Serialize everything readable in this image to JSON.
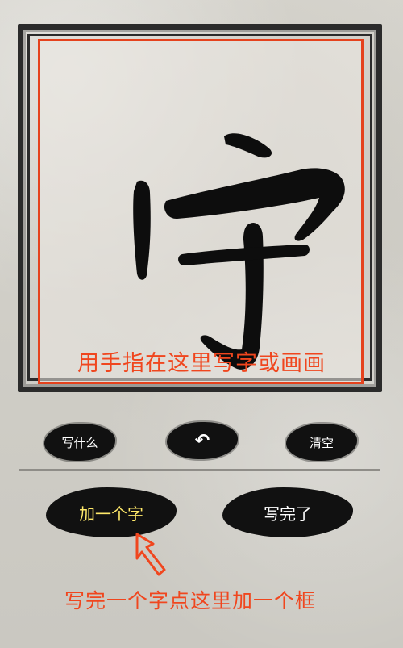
{
  "canvas": {
    "instruction": "用手指在这里写字或画画",
    "current_character": "字"
  },
  "toolbar": {
    "what_to_write": "写什么",
    "undo_icon": "undo-arrow-icon",
    "clear": "清空"
  },
  "actions": {
    "add_character": "加一个字",
    "finish": "写完了"
  },
  "footer": {
    "hint": "写完一个字点这里加一个框"
  },
  "colors": {
    "accent": "#f0461e",
    "ink": "#111111",
    "highlight_text": "#ffe96a"
  }
}
